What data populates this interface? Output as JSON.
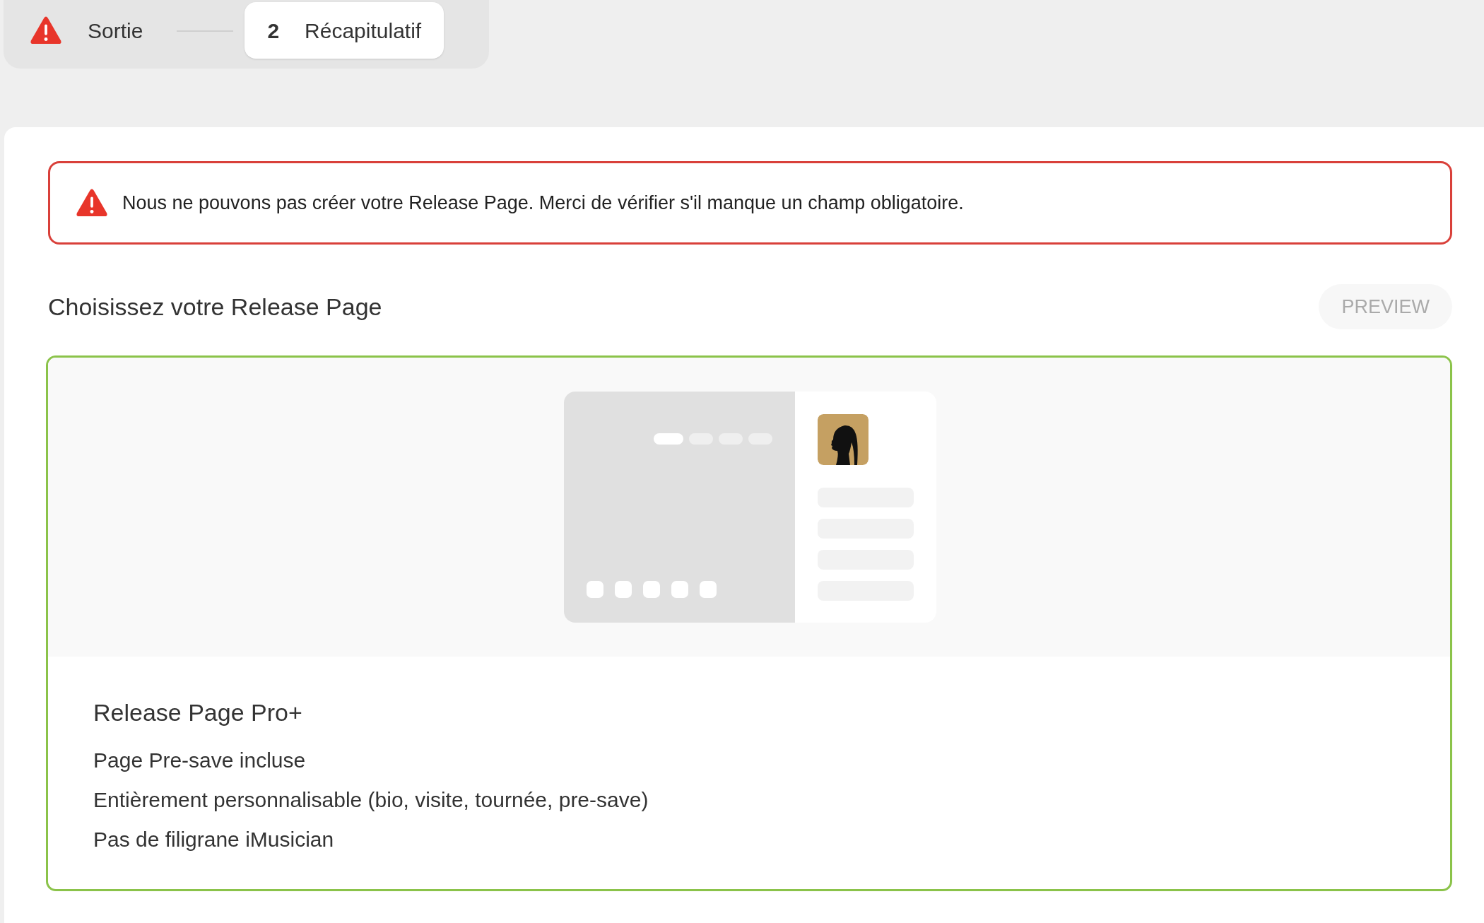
{
  "stepper": {
    "steps": [
      {
        "kind": "warning",
        "label": "Sortie",
        "selected": false
      },
      {
        "kind": "number",
        "number": "2",
        "label": "Récapitulatif",
        "selected": true
      }
    ]
  },
  "alert": {
    "kind": "error",
    "message": "Nous ne pouvons pas créer votre Release Page. Merci de vérifier s'il manque un champ obligatoire."
  },
  "section": {
    "title": "Choisissez votre Release Page",
    "preview_button": {
      "label": "PREVIEW",
      "disabled": true
    }
  },
  "options": [
    {
      "title": "Release Page Pro+",
      "selected": true,
      "features": [
        "Page Pre-save incluse",
        "Entièrement personnalisable (bio, visite, tournée, pre-save)",
        "Pas de filigrane iMusician"
      ]
    }
  ]
}
